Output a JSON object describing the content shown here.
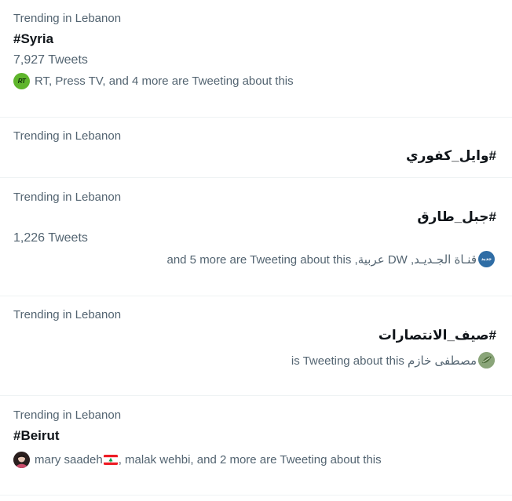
{
  "trends": [
    {
      "meta": "Trending in Lebanon",
      "hashtag": "#Syria",
      "count": "7,927 Tweets",
      "context": "RT, Press TV, and 4 more are Tweeting about this",
      "avatar_icon": "rt-logo-icon"
    },
    {
      "meta": "Trending in Lebanon",
      "hashtag": "#وايل_كفوري"
    },
    {
      "meta": "Trending in Lebanon",
      "hashtag": "#جبل_طارق",
      "count": "1,226 Tweets",
      "context": "قنـاة الجـديـد, DW عربية, and 5 more are Tweeting about this",
      "avatar_icon": "aljadeed-logo-icon"
    },
    {
      "meta": "Trending in Lebanon",
      "hashtag": "#صيف_الانتصارات",
      "context": "مصطفى خازم is Tweeting about this",
      "avatar_icon": "leaf-avatar-icon"
    },
    {
      "meta": "Trending in Lebanon",
      "hashtag": "#Beirut",
      "context_name": "mary saadeh",
      "context_rest": ", malak wehbi, and 2 more are Tweeting about this",
      "flag_icon": "lebanon-flag-icon",
      "avatar_icon": "person-avatar-icon"
    }
  ],
  "colors": {
    "text_primary": "#0f1419",
    "text_secondary": "#536471",
    "divider": "#eff3f4",
    "rt_green": "#5fb52c",
    "jadeed_blue": "#2f6da5"
  }
}
